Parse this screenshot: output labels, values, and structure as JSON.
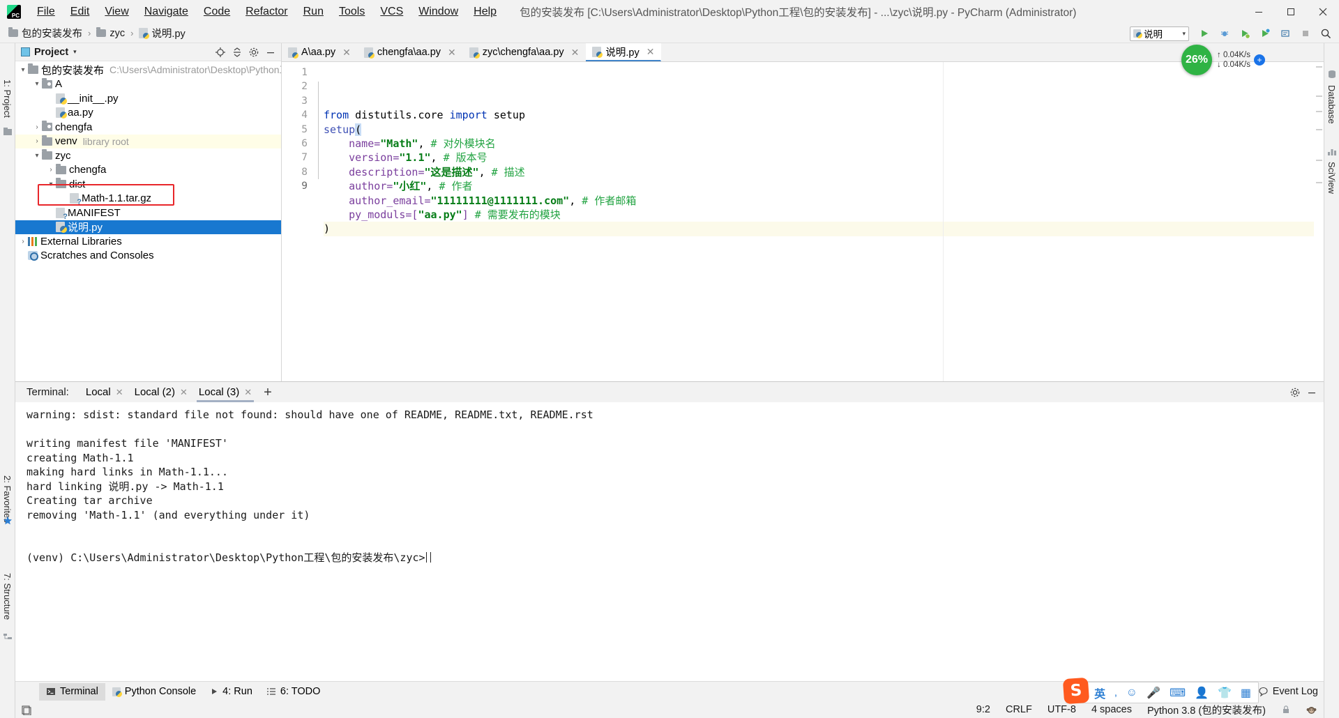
{
  "window": {
    "title": "包的安装发布 [C:\\Users\\Administrator\\Desktop\\Python工程\\包的安装发布] - ...\\zyc\\说明.py - PyCharm (Administrator)",
    "minimize": "—",
    "maximize": "❐",
    "close": "✕"
  },
  "menu": [
    {
      "label": "File"
    },
    {
      "label": "Edit"
    },
    {
      "label": "View"
    },
    {
      "label": "Navigate"
    },
    {
      "label": "Code"
    },
    {
      "label": "Refactor"
    },
    {
      "label": "Run"
    },
    {
      "label": "Tools"
    },
    {
      "label": "VCS"
    },
    {
      "label": "Window"
    },
    {
      "label": "Help"
    }
  ],
  "breadcrumb": {
    "items": [
      "包的安装发布",
      "zyc",
      "说明.py"
    ],
    "separator": "›"
  },
  "navbar": {
    "run_config": "说明",
    "run_config_caret": "⌄",
    "buttons": [
      "run-button",
      "debug-button",
      "run-coverage-button",
      "profile-button",
      "attach-button",
      "stop-button",
      "search-everywhere-button"
    ]
  },
  "left_strip": {
    "project_label": "1: Project",
    "favorites_label": "2: Favorites",
    "structure_label": "7: Structure"
  },
  "right_strip": {
    "database_label": "Database",
    "sciview_label": "SciView"
  },
  "project_pane": {
    "title": "Project",
    "caret": "▾",
    "actions": [
      "locate-button",
      "collapse-all-button",
      "settings-gear-button",
      "hide-button"
    ],
    "tree": [
      {
        "depth": 0,
        "arrow": "▾",
        "icon": "folder",
        "label": "包的安装发布",
        "sub": "C:\\Users\\Administrator\\Desktop\\Python工程",
        "state": "normal"
      },
      {
        "depth": 1,
        "arrow": "▾",
        "icon": "folder-src",
        "label": "A",
        "sub": "",
        "state": "normal"
      },
      {
        "depth": 2,
        "arrow": "",
        "icon": "python",
        "label": "__init__.py",
        "sub": "",
        "state": "normal"
      },
      {
        "depth": 2,
        "arrow": "",
        "icon": "python",
        "label": "aa.py",
        "sub": "",
        "state": "normal"
      },
      {
        "depth": 1,
        "arrow": "›",
        "icon": "folder-src",
        "label": "chengfa",
        "sub": "",
        "state": "normal"
      },
      {
        "depth": 1,
        "arrow": "›",
        "icon": "folder",
        "label": "venv",
        "sub": "library root",
        "state": "venv"
      },
      {
        "depth": 1,
        "arrow": "▾",
        "icon": "folder",
        "label": "zyc",
        "sub": "",
        "state": "normal"
      },
      {
        "depth": 2,
        "arrow": "›",
        "icon": "folder",
        "label": "chengfa",
        "sub": "",
        "state": "normal"
      },
      {
        "depth": 2,
        "arrow": "▾",
        "icon": "folder",
        "label": "dist",
        "sub": "",
        "state": "normal"
      },
      {
        "depth": 3,
        "arrow": "",
        "icon": "unknown",
        "label": "Math-1.1.tar.gz",
        "sub": "",
        "state": "normal"
      },
      {
        "depth": 2,
        "arrow": "",
        "icon": "unknown",
        "label": "MANIFEST",
        "sub": "",
        "state": "normal"
      },
      {
        "depth": 2,
        "arrow": "",
        "icon": "python",
        "label": "说明.py",
        "sub": "",
        "state": "selected"
      },
      {
        "depth": 0,
        "arrow": "›",
        "icon": "library",
        "label": "External Libraries",
        "sub": "",
        "state": "normal"
      },
      {
        "depth": 0,
        "arrow": "",
        "icon": "scratches",
        "label": "Scratches and Consoles",
        "sub": "",
        "state": "normal"
      }
    ]
  },
  "editor": {
    "tabs": [
      {
        "label": "A\\aa.py",
        "active": false,
        "close": "✕"
      },
      {
        "label": "chengfa\\aa.py",
        "active": false,
        "close": "✕"
      },
      {
        "label": "zyc\\chengfa\\aa.py",
        "active": false,
        "close": "✕"
      },
      {
        "label": "说明.py",
        "active": true,
        "close": "✕"
      }
    ],
    "line_numbers": [
      "1",
      "2",
      "3",
      "4",
      "5",
      "6",
      "7",
      "8",
      "9"
    ],
    "lines": [
      {
        "n": 1,
        "current": false,
        "tokens": [
          {
            "t": "from ",
            "c": "kw"
          },
          {
            "t": "distutils.core ",
            "c": "id"
          },
          {
            "t": "import ",
            "c": "kw"
          },
          {
            "t": "setup",
            "c": "id"
          }
        ]
      },
      {
        "n": 2,
        "current": false,
        "tokens": [
          {
            "t": "setup",
            "c": "fn"
          },
          {
            "t": "(",
            "c": "sel-paren"
          }
        ]
      },
      {
        "n": 3,
        "current": false,
        "tokens": [
          {
            "t": "    name=",
            "c": "param"
          },
          {
            "t": "\"Math\"",
            "c": "str"
          },
          {
            "t": ",",
            "c": "id"
          },
          {
            "t": " # 对外模块名",
            "c": "cmt-cn"
          }
        ]
      },
      {
        "n": 4,
        "current": false,
        "tokens": [
          {
            "t": "    version=",
            "c": "param"
          },
          {
            "t": "\"1.1\"",
            "c": "str"
          },
          {
            "t": ",",
            "c": "id"
          },
          {
            "t": " # 版本号",
            "c": "cmt-cn"
          }
        ]
      },
      {
        "n": 5,
        "current": false,
        "tokens": [
          {
            "t": "    description=",
            "c": "param"
          },
          {
            "t": "\"这是描述\"",
            "c": "str"
          },
          {
            "t": ",",
            "c": "id"
          },
          {
            "t": " # 描述",
            "c": "cmt-cn"
          }
        ]
      },
      {
        "n": 6,
        "current": false,
        "tokens": [
          {
            "t": "    author=",
            "c": "param"
          },
          {
            "t": "\"小红\"",
            "c": "str"
          },
          {
            "t": ",",
            "c": "id"
          },
          {
            "t": " # 作者",
            "c": "cmt-cn"
          }
        ]
      },
      {
        "n": 7,
        "current": false,
        "tokens": [
          {
            "t": "    author_email=",
            "c": "param"
          },
          {
            "t": "\"11111111@1111111.com\"",
            "c": "str"
          },
          {
            "t": ",",
            "c": "id"
          },
          {
            "t": " # 作者邮箱",
            "c": "cmt-cn"
          }
        ]
      },
      {
        "n": 8,
        "current": false,
        "tokens": [
          {
            "t": "    py_moduls=[",
            "c": "param"
          },
          {
            "t": "\"aa.py\"",
            "c": "str"
          },
          {
            "t": "]",
            "c": "param"
          },
          {
            "t": " # 需要发布的模块",
            "c": "cmt-cn"
          }
        ]
      },
      {
        "n": 9,
        "current": true,
        "tokens": [
          {
            "t": ")",
            "c": "id"
          }
        ]
      }
    ],
    "full_text": "from distutils.core import setup\nsetup(\n    name=\"Math\", # 对外模块名\n    version=\"1.1\", # 版本号\n    description=\"这是描述\", # 描述\n    author=\"小红\", # 作者\n    author_email=\"11111111@1111111.com\", # 作者邮箱\n    py_moduls=[\"aa.py\"] # 需要发布的模块\n)"
  },
  "terminal": {
    "label": "Terminal:",
    "tabs": [
      {
        "label": "Local",
        "active": false,
        "close": "✕"
      },
      {
        "label": "Local (2)",
        "active": false,
        "close": "✕"
      },
      {
        "label": "Local (3)",
        "active": true,
        "close": "✕"
      }
    ],
    "add_tab": "+",
    "settings_icon": "gear-icon",
    "hide_icon": "minimize-icon",
    "output": [
      "warning: sdist: standard file not found: should have one of README, README.txt, README.rst",
      "",
      "writing manifest file 'MANIFEST'",
      "creating Math-1.1",
      "making hard links in Math-1.1...",
      "hard linking 说明.py -> Math-1.1",
      "Creating tar archive",
      "removing 'Math-1.1' (and everything under it)",
      "",
      ""
    ],
    "prompt": "(venv) C:\\Users\\Administrator\\Desktop\\Python工程\\包的安装发布\\zyc>"
  },
  "statusbar": {
    "tools": [
      {
        "label": "Terminal",
        "icon": "terminal-icon",
        "active": true
      },
      {
        "label": "Python Console",
        "icon": "python-icon",
        "active": false
      },
      {
        "label": "4: Run",
        "icon": "run-icon",
        "active": false
      },
      {
        "label": "6: TODO",
        "icon": "todo-icon",
        "active": false
      }
    ],
    "event_log": "Event Log"
  },
  "statusbar2": {
    "position": "9:2",
    "line_separator": "CRLF",
    "encoding": "UTF-8",
    "indent": "4 spaces",
    "interpreter": "Python 3.8 (包的安装发布)",
    "lock_icon": "lock-icon",
    "monkey_icon": "monkey-icon"
  },
  "ime": {
    "lang": "英",
    "items": [
      "punctuation-icon",
      "emoji-icon",
      "microphone-icon",
      "keyboard-icon",
      "user-icon",
      "skin-icon",
      "apps-icon"
    ],
    "logo": "S"
  },
  "network_widget": {
    "cpu": "26%",
    "upload": "0.04K/s",
    "download": "0.04K/s",
    "up_arrow": "↑",
    "down_arrow": "↓",
    "plus": "+"
  },
  "colors": {
    "accent": "#1878d0",
    "highlight_box": "#e8262a",
    "string": "#067d17",
    "keyword": "#0033b3",
    "comment": "#21a341",
    "param": "#7a3e9d",
    "venv_row": "#fffde7",
    "cpu_green": "#2fb344"
  }
}
